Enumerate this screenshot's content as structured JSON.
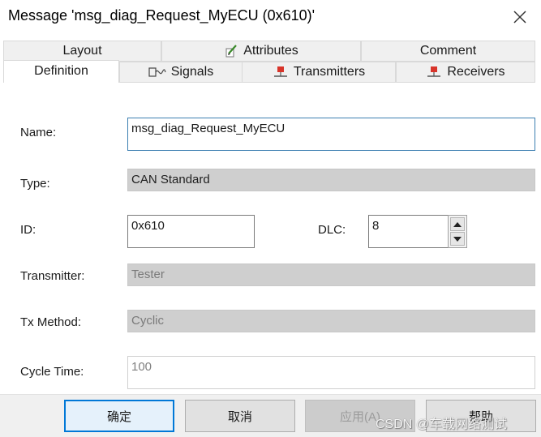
{
  "window": {
    "title": "Message 'msg_diag_Request_MyECU (0x610)'"
  },
  "tabs_top": [
    {
      "label": "Layout"
    },
    {
      "label": "Attributes",
      "icon": "edit-pencil-icon"
    },
    {
      "label": "Comment"
    }
  ],
  "tabs_bottom": [
    {
      "label": "Definition",
      "active": true
    },
    {
      "label": "Signals",
      "icon": "signals-icon"
    },
    {
      "label": "Transmitters",
      "icon": "transmitter-node-icon"
    },
    {
      "label": "Receivers",
      "icon": "receiver-node-icon"
    }
  ],
  "form": {
    "name_label": "Name:",
    "name_value": "msg_diag_Request_MyECU",
    "type_label": "Type:",
    "type_value": "CAN Standard",
    "id_label": "ID:",
    "id_value": "0x610",
    "dlc_label": "DLC:",
    "dlc_value": "8",
    "transmitter_label": "Transmitter:",
    "transmitter_value": "Tester",
    "tx_method_label": "Tx Method:",
    "tx_method_value": "Cyclic",
    "cycle_time_label": "Cycle Time:",
    "cycle_time_value": "100"
  },
  "buttons": {
    "ok": "确定",
    "cancel": "取消",
    "apply": "应用(A)",
    "help": "帮助"
  },
  "watermark": "CSDN @车载网络测试",
  "colors": {
    "accent": "#0078d7",
    "node_icon_red": "#d8342a"
  }
}
